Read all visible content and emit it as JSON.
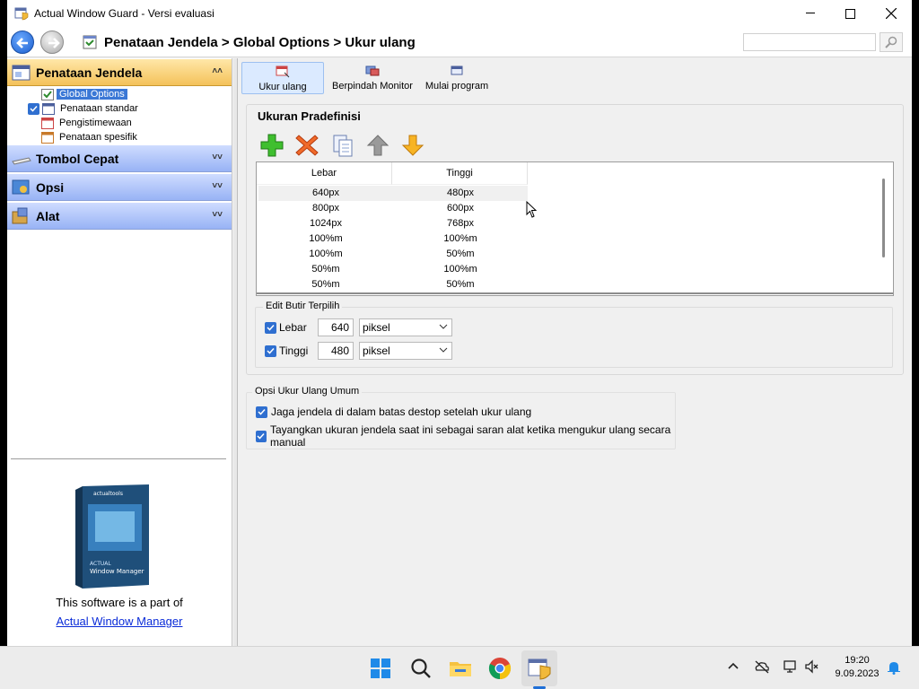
{
  "window": {
    "title": "Actual Window Guard - Versi evaluasi",
    "breadcrumb": "Penataan Jendela > Global Options > Ukur ulang",
    "search_placeholder": ""
  },
  "sidebar": {
    "groups": [
      {
        "label": "Penataan Jendela",
        "icon": "window-layout-icon",
        "expanded": true
      },
      {
        "label": "Tombol Cepat",
        "icon": "keyboard-icon",
        "expanded": false
      },
      {
        "label": "Opsi",
        "icon": "options-icon",
        "expanded": false
      },
      {
        "label": "Alat",
        "icon": "tools-icon",
        "expanded": false
      }
    ],
    "tree": [
      {
        "label": "Global Options",
        "selected": true
      },
      {
        "label": "Penataan standar",
        "checked": true
      },
      {
        "label": "Pengistimewaan"
      },
      {
        "label": "Penataan spesifik"
      }
    ],
    "promo_text": "This software is a part of",
    "promo_link": "Actual Window Manager",
    "box_brand": "actualtools",
    "box_line1": "ACTUAL",
    "box_line2": "Window Manager"
  },
  "toolbar": {
    "tabs": [
      {
        "label": "Ukur ulang",
        "active": true
      },
      {
        "label": "Berpindah Monitor"
      },
      {
        "label": "Mulai program"
      }
    ]
  },
  "predefined": {
    "title": "Ukuran Pradefinisi",
    "actions": [
      "add-icon",
      "delete-icon",
      "copy-icon",
      "move-up-icon",
      "move-down-icon"
    ],
    "columns": [
      "Lebar",
      "Tinggi"
    ],
    "rows": [
      [
        "640px",
        "480px"
      ],
      [
        "800px",
        "600px"
      ],
      [
        "1024px",
        "768px"
      ],
      [
        "100%m",
        "100%m"
      ],
      [
        "100%m",
        "50%m"
      ],
      [
        "50%m",
        "100%m"
      ],
      [
        "50%m",
        "50%m"
      ]
    ],
    "selected_row": 0
  },
  "edit": {
    "legend": "Edit Butir Terpilih",
    "width_label": "Lebar",
    "width_value": "640",
    "width_unit": "piksel",
    "height_label": "Tinggi",
    "height_value": "480",
    "height_unit": "piksel"
  },
  "general": {
    "legend": "Opsi Ukur Ulang Umum",
    "option1": "Jaga jendela di dalam batas destop setelah ukur ulang",
    "option2": "Tayangkan ukuran jendela saat ini sebagai saran alat ketika mengukur ulang secara manual"
  },
  "taskbar": {
    "time": "19:20",
    "date": "9.09.2023"
  },
  "colors": {
    "accent": "#2f6fd0",
    "group_active": "#f4c25a",
    "group_inactive": "#98b3f5",
    "link": "#0a2bd8"
  }
}
